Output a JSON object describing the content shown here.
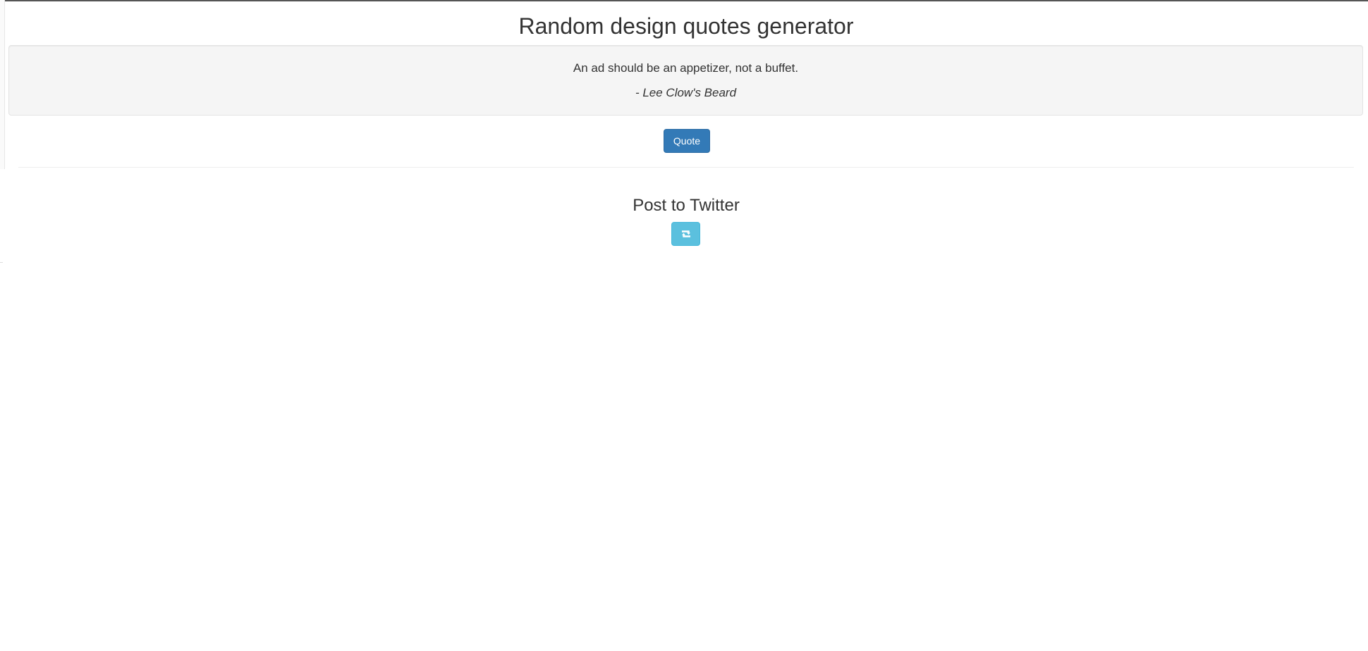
{
  "page": {
    "title": "Random design quotes generator"
  },
  "quote": {
    "text": "An ad should be an appetizer, not a buffet.",
    "author": "- Lee Clow's Beard"
  },
  "actions": {
    "quote_button_label": "Quote"
  },
  "twitter": {
    "heading": "Post to Twitter",
    "button_icon": "retweet-icon"
  },
  "colors": {
    "primary_button": "#337ab7",
    "info_button": "#5bc0de",
    "well_background": "#f5f5f5",
    "text": "#333333"
  }
}
